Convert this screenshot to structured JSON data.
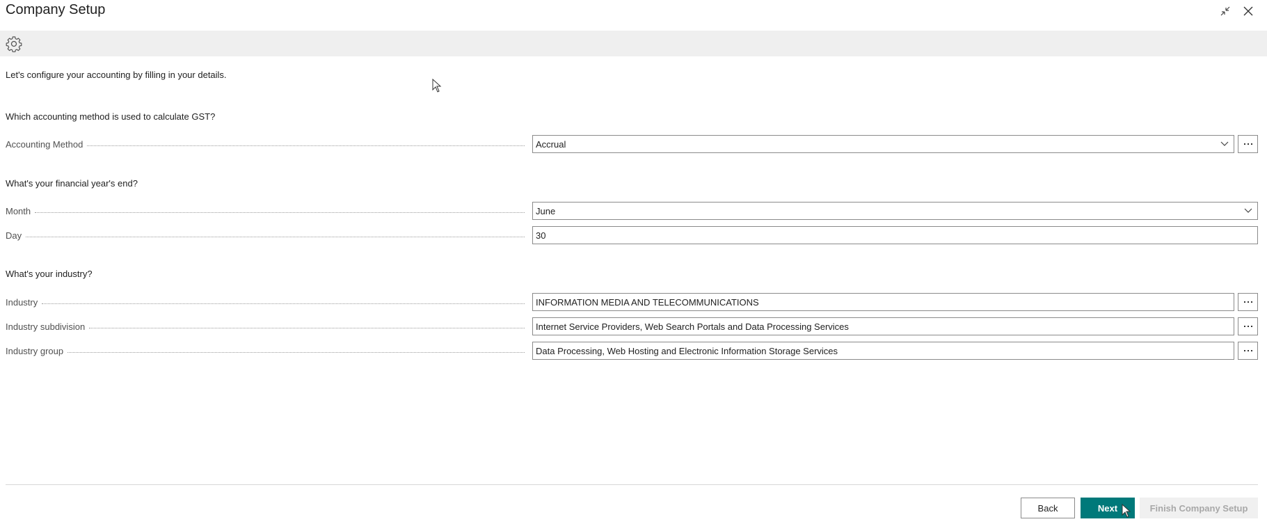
{
  "window": {
    "title": "Company Setup"
  },
  "intro_text": "Let's configure your accounting by filling in your details.",
  "sections": {
    "gst": {
      "question": "Which accounting method is used to calculate GST?",
      "accounting_method": {
        "label": "Accounting Method",
        "value": "Accrual"
      }
    },
    "financial_year": {
      "question": "What's your financial year's end?",
      "month": {
        "label": "Month",
        "value": "June"
      },
      "day": {
        "label": "Day",
        "value": "30"
      }
    },
    "industry": {
      "question": "What's your industry?",
      "industry": {
        "label": "Industry",
        "value": "INFORMATION MEDIA AND TELECOMMUNICATIONS"
      },
      "subdivision": {
        "label": "Industry subdivision",
        "value": "Internet Service Providers, Web Search Portals and Data Processing Services"
      },
      "group": {
        "label": "Industry group",
        "value": "Data Processing, Web Hosting and Electronic Information Storage Services"
      }
    }
  },
  "footer": {
    "back_label": "Back",
    "next_label": "Next",
    "finish_label": "Finish Company Setup"
  },
  "icons": {
    "toolbar": "gear-icon",
    "collapse": "collapse-icon",
    "close": "close-icon",
    "dropdown": "chevron-down-icon",
    "lookup": "more-options-icon"
  },
  "colors": {
    "accent": "#00797a",
    "toolbar_bg": "#efefef",
    "disabled_bg": "#f0f0f0",
    "disabled_text": "#a8a8a8"
  }
}
